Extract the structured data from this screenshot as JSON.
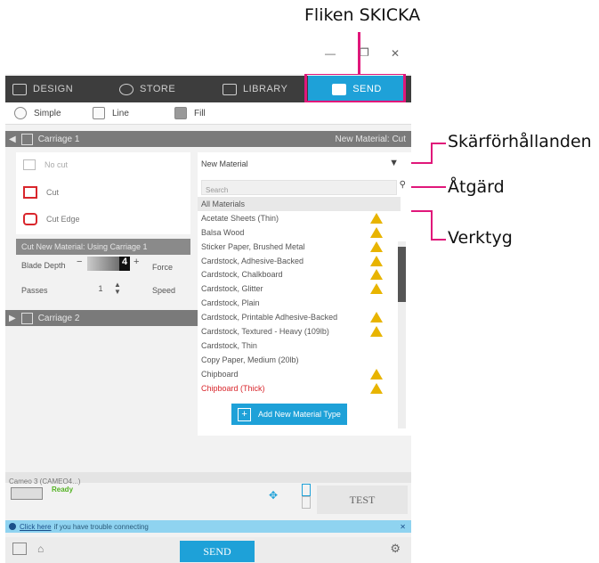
{
  "callouts": {
    "tab_send": "Fliken SKICKA",
    "cut_settings": "Skärförhållanden",
    "action": "Åtgärd",
    "tool": "Verktyg"
  },
  "window": {
    "minimize": "—",
    "restore": "❐",
    "close": "✕"
  },
  "tabs": [
    {
      "label": "DESIGN",
      "icon": "grid-icon"
    },
    {
      "label": "STORE",
      "icon": "shop-icon"
    },
    {
      "label": "LIBRARY",
      "icon": "library-icon"
    },
    {
      "label": "SEND",
      "icon": "cutter-icon"
    }
  ],
  "modes": [
    "Simple",
    "Line",
    "Fill"
  ],
  "carriage1": {
    "title": "Carriage 1",
    "material_right": "New Material: Cut"
  },
  "actions": [
    "No cut",
    "Cut",
    "Cut Edge"
  ],
  "cut_new_material": "Cut New Material: Using Carriage 1",
  "settings": {
    "blade_depth_label": "Blade Depth",
    "blade_depth_value": "4",
    "passes_label": "Passes",
    "passes_value": "1",
    "force_label": "Force",
    "speed_label": "Speed"
  },
  "carriage2": {
    "title": "Carriage 2"
  },
  "material": {
    "selected": "New Material",
    "search_placeholder": "Search",
    "items": [
      {
        "label": "All Materials",
        "warn": false,
        "selected": true
      },
      {
        "label": "Acetate Sheets (Thin)",
        "warn": true
      },
      {
        "label": "Balsa Wood",
        "warn": true
      },
      {
        "label": "Sticker Paper, Brushed Metal",
        "warn": true
      },
      {
        "label": "Cardstock, Adhesive-Backed",
        "warn": true
      },
      {
        "label": "Cardstock, Chalkboard",
        "warn": true
      },
      {
        "label": "Cardstock, Glitter",
        "warn": true
      },
      {
        "label": "Cardstock, Plain",
        "warn": false
      },
      {
        "label": "Cardstock, Printable Adhesive-Backed",
        "warn": true
      },
      {
        "label": "Cardstock, Textured - Heavy (109lb)",
        "warn": true
      },
      {
        "label": "Cardstock, Thin",
        "warn": false
      },
      {
        "label": "Copy Paper, Medium (20lb)",
        "warn": false
      },
      {
        "label": "Chipboard",
        "warn": true
      },
      {
        "label": "Chipboard (Thick)",
        "warn": true
      }
    ],
    "add_button": "Add New Material Type"
  },
  "device": {
    "name": "Cameo 3 (CAMEO4...)",
    "status": "Ready",
    "test": "TEST"
  },
  "notice": {
    "link": "Click here",
    "text": "if you have trouble connecting"
  },
  "bottom": {
    "send": "SEND"
  },
  "colors": {
    "accent": "#1ea1d8",
    "highlight": "#e0177a",
    "red": "#d9262c",
    "warn": "#e8b400",
    "green": "#55b325"
  }
}
